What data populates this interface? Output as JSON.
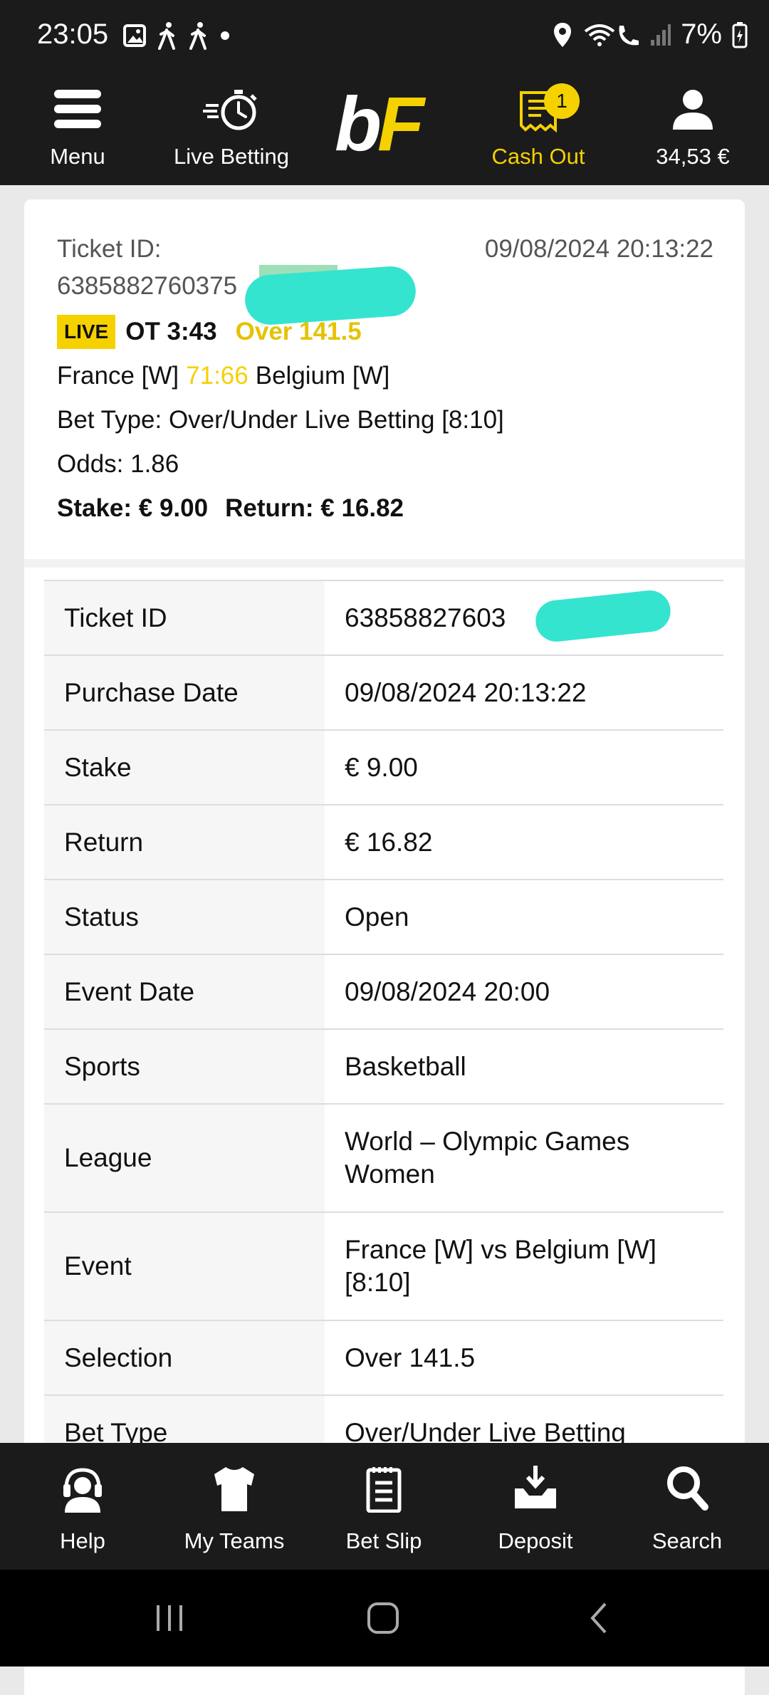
{
  "status_bar": {
    "time": "23:05",
    "battery": "7%"
  },
  "header": {
    "menu_label": "Menu",
    "live_label": "Live Betting",
    "logo_b": "b",
    "logo_f": "F",
    "cashout_label": "Cash Out",
    "cashout_badge": "1",
    "balance": "34,53 €",
    "accent": "#f5d100"
  },
  "ticket": {
    "id_label": "Ticket ID:",
    "id_value": "6385882760375",
    "date": "09/08/2024  20:13:22",
    "live": "LIVE",
    "ot": "OT 3:43",
    "selection": "Over 141.5",
    "home": "France [W]",
    "score": "71:66",
    "away": "Belgium [W]",
    "bet_type": "Bet Type: Over/Under Live Betting  [8:10]",
    "odds": "Odds: 1.86",
    "stake": "Stake: € 9.00",
    "return": "Return: € 16.82"
  },
  "details": [
    {
      "label": "Ticket ID",
      "value": "63858827603"
    },
    {
      "label": "Purchase Date",
      "value": "09/08/2024 20:13:22"
    },
    {
      "label": "Stake",
      "value": "€ 9.00"
    },
    {
      "label": "Return",
      "value": "€ 16.82"
    },
    {
      "label": "Status",
      "value": "Open"
    },
    {
      "label": "Event Date",
      "value": "09/08/2024 20:00"
    },
    {
      "label": "Sports",
      "value": "Basketball"
    },
    {
      "label": "League",
      "value": "World – Olympic Games Women"
    },
    {
      "label": "Event",
      "value": "France [W] vs Belgium [W] [8:10]"
    },
    {
      "label": "Selection",
      "value": "Over 141.5"
    },
    {
      "label": "Bet Type",
      "value": "Over/Under Live Betting"
    }
  ],
  "bottom_nav": {
    "help": "Help",
    "my_teams": "My Teams",
    "bet_slip": "Bet Slip",
    "deposit": "Deposit",
    "search": "Search"
  }
}
